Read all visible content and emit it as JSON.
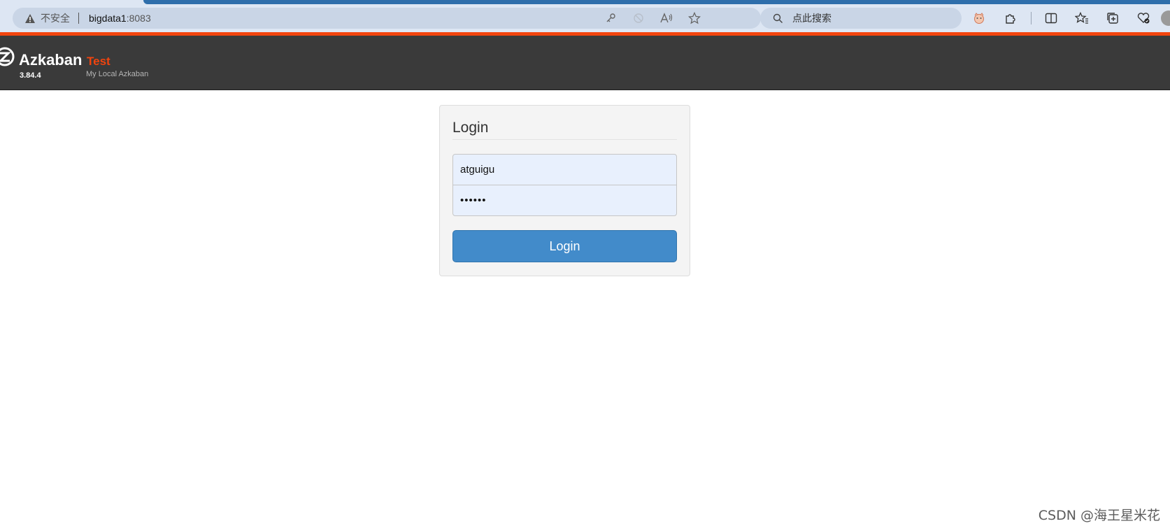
{
  "browser": {
    "security_label": "不安全",
    "url_host": "bigdata1",
    "url_port": ":8083",
    "search_placeholder": "点此搜索",
    "icons": [
      "warning-icon",
      "key-icon",
      "blocked-icon",
      "read-aloud-icon",
      "favorite-star-icon",
      "search-icon",
      "extension-pet-icon",
      "extensions-icon",
      "split-screen-icon",
      "favorites-icon",
      "collections-icon",
      "performance-icon",
      "profile-avatar"
    ]
  },
  "header": {
    "brand": "Azkaban",
    "version": "3.84.4",
    "environment": "Test",
    "subtitle": "My Local Azkaban",
    "accent_color": "#f1440e",
    "background_color": "#3a3a3a"
  },
  "login": {
    "title": "Login",
    "username_value": "atguigu",
    "password_value": "••••••",
    "button_label": "Login",
    "button_color": "#428bca"
  },
  "watermark": "CSDN @海王星米花"
}
